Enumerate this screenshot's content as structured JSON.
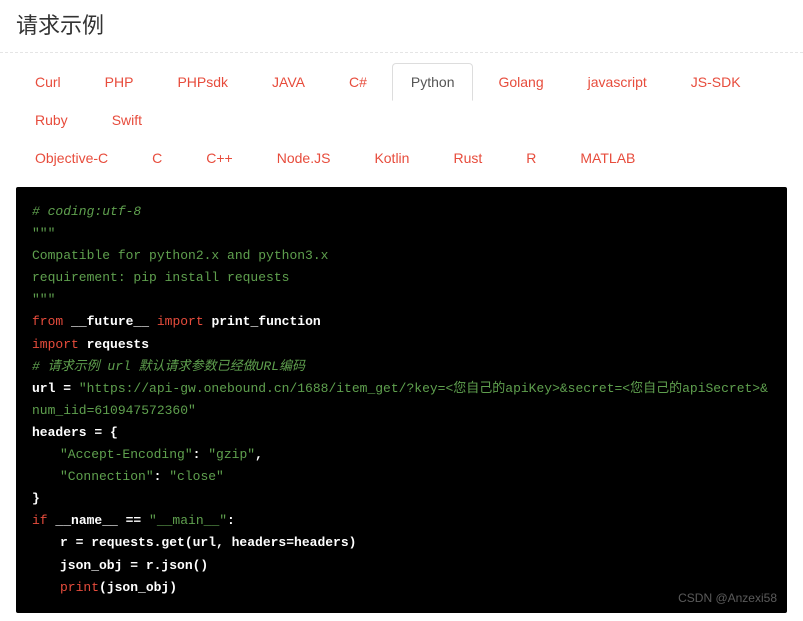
{
  "title": "请求示例",
  "tabs": {
    "row1": [
      "Curl",
      "PHP",
      "PHPsdk",
      "JAVA",
      "C#",
      "Python",
      "Golang",
      "javascript",
      "JS-SDK",
      "Ruby",
      "Swift"
    ],
    "row2": [
      "Objective-C",
      "C",
      "C++",
      "Node.JS",
      "Kotlin",
      "Rust",
      "R",
      "MATLAB"
    ],
    "active": "Python"
  },
  "code": {
    "coding": "# coding:utf-8",
    "tq1": "\"\"\"",
    "doc1": "Compatible for python2.x and python3.x",
    "doc2": "requirement: pip install requests",
    "tq2": "\"\"\"",
    "kw_from": "from",
    "mod_future": " __future__ ",
    "kw_import": "import",
    "sym_print": " print_function",
    "kw_import2": "import",
    "mod_requests": " requests",
    "cmt_url": "# 请求示例 url 默认请求参数已经做URL编码",
    "var_url": "url = ",
    "str_url": "\"https://api-gw.onebound.cn/1688/item_get/?key=<您自己的apiKey>&secret=<您自己的apiSecret>&num_iid=610947572360\"",
    "var_headers": "headers = {",
    "hdr1_k": "\"Accept-Encoding\"",
    "colon": ": ",
    "hdr1_v": "\"gzip\"",
    "comma": ",",
    "hdr2_k": "\"Connection\"",
    "hdr2_v": "\"close\"",
    "brace_close": "}",
    "kw_if": "if",
    "name_eq": " __name__ == ",
    "str_main": "\"__main__\"",
    "colon2": ":",
    "line_r": "r = requests.get(url, headers=headers)",
    "line_json": "json_obj = r.json()",
    "kw_print": "print",
    "print_arg": "(json_obj)"
  },
  "watermark": "CSDN @Anzexi58"
}
